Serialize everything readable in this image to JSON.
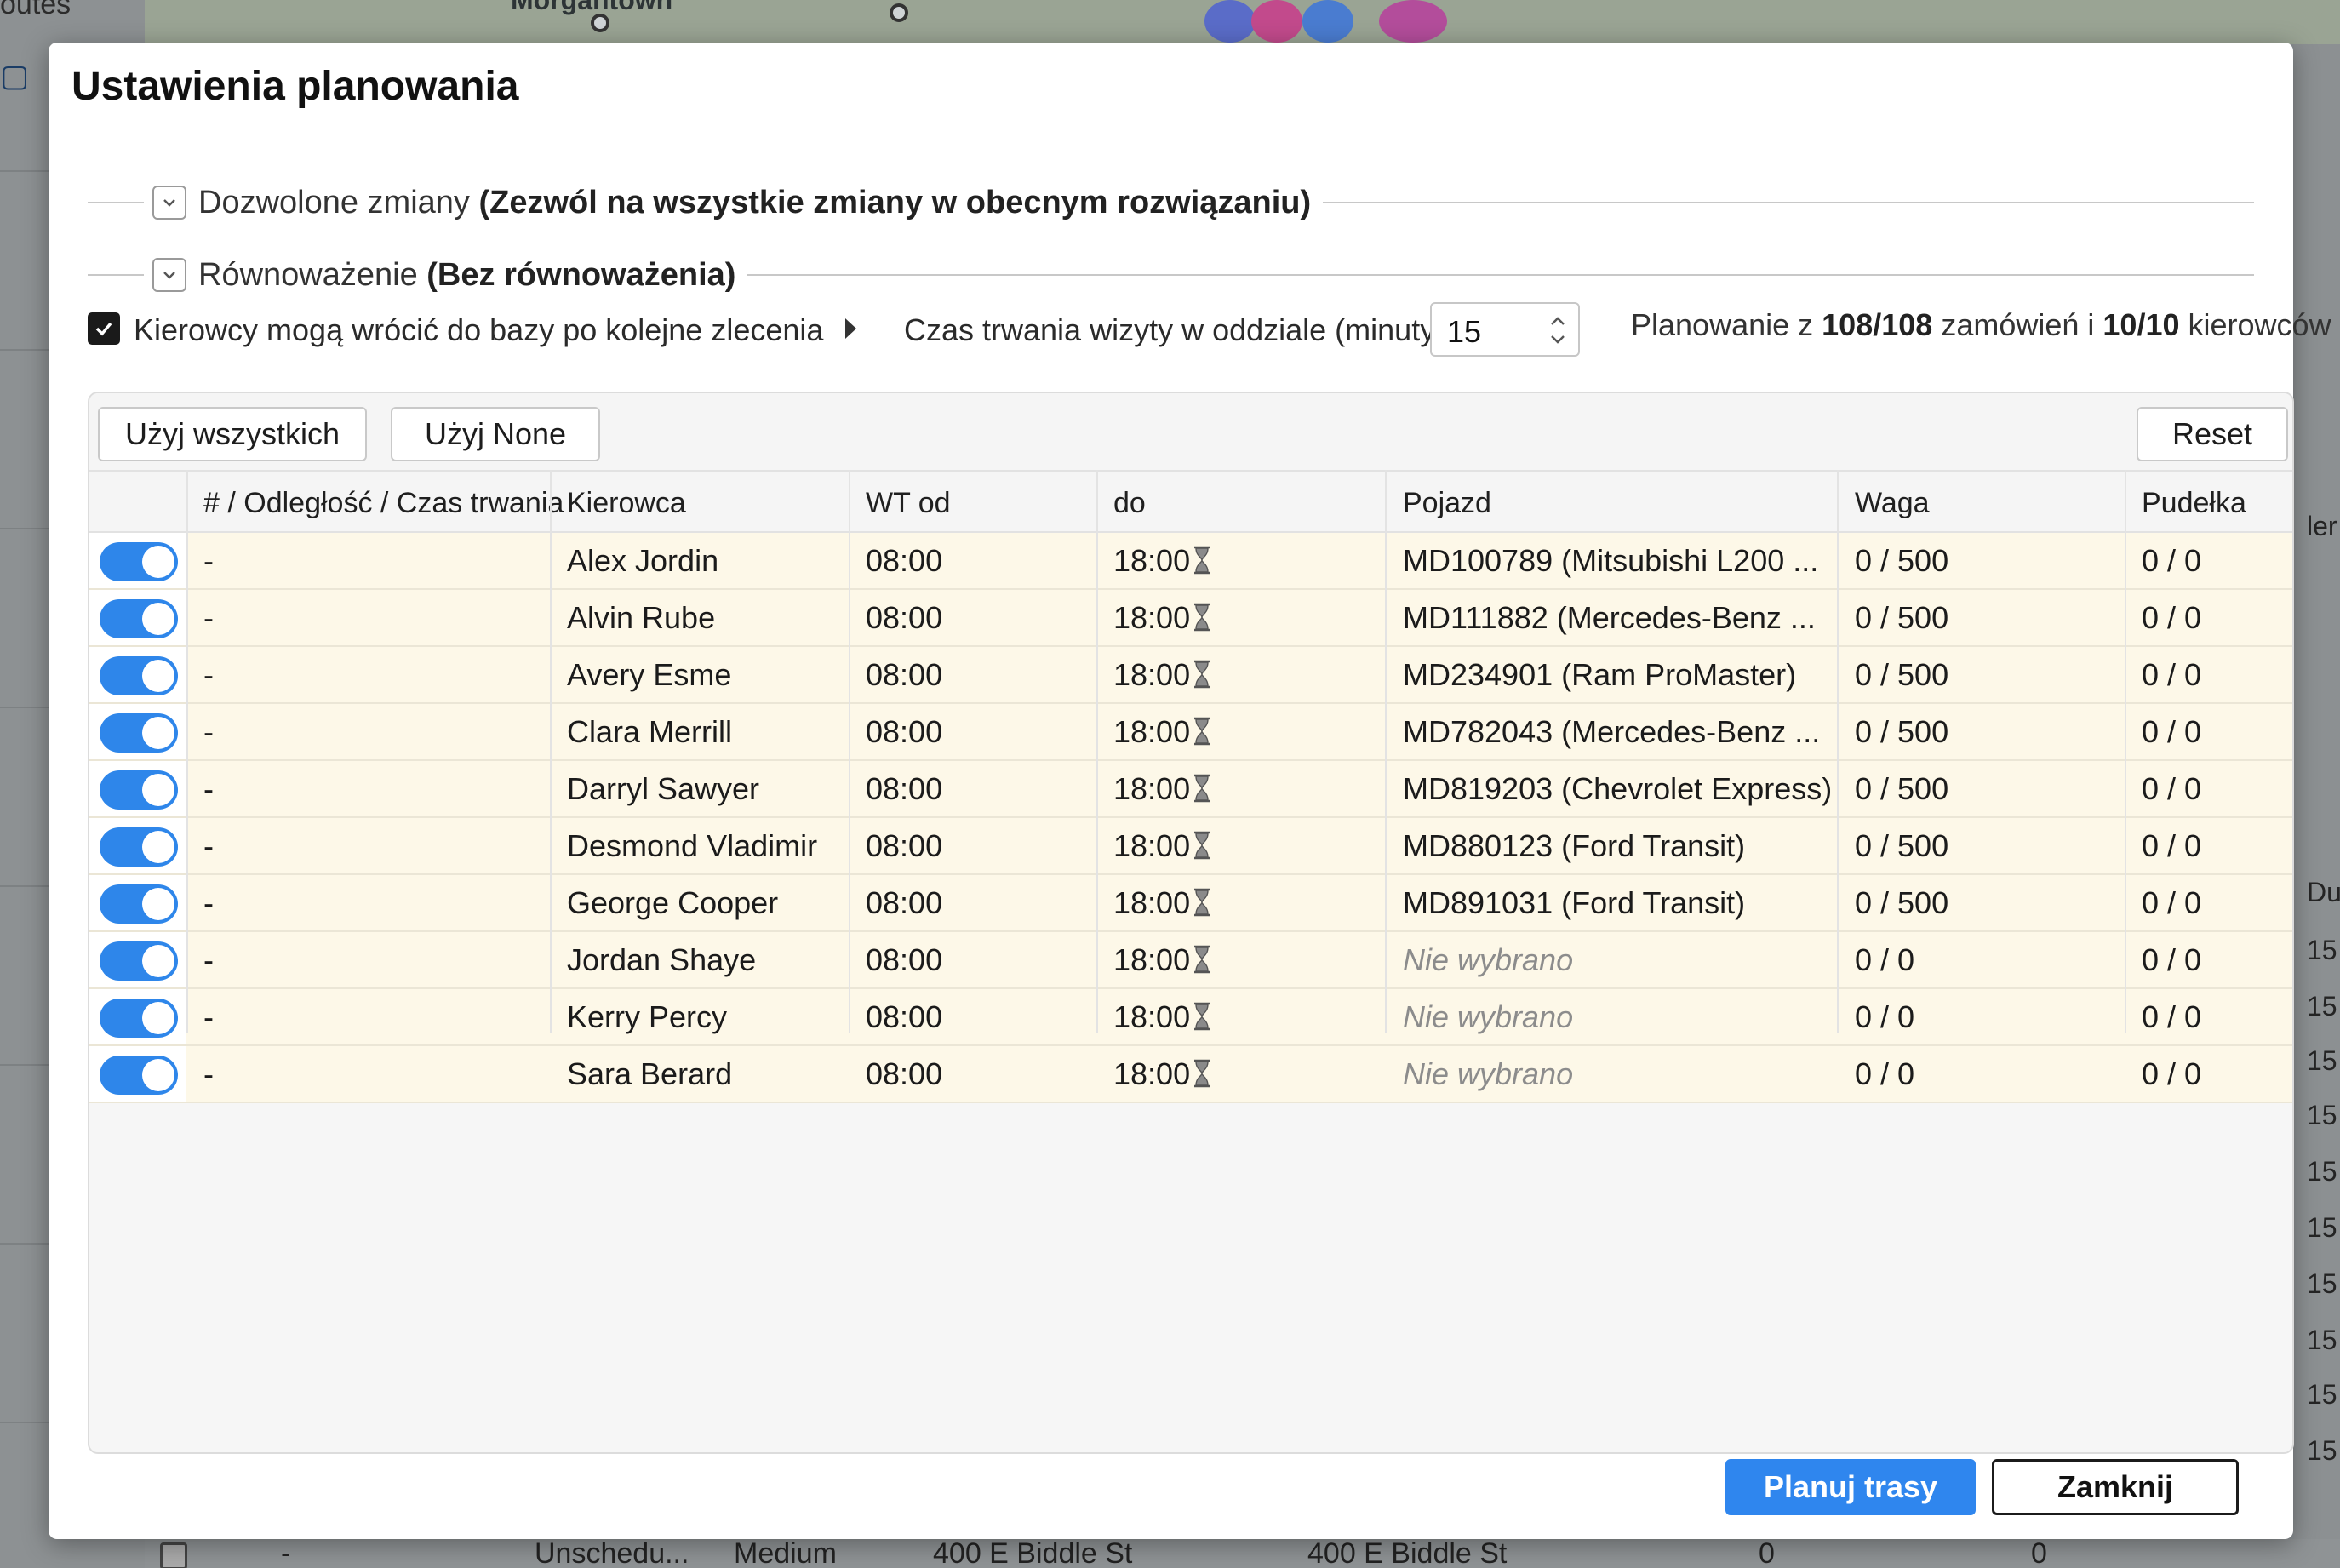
{
  "background": {
    "routes_label": "outes",
    "place_label": "Morgantown",
    "right_labels": [
      "ler",
      "Du",
      "15",
      "15",
      "15",
      "15",
      "15",
      "15",
      "15",
      "15",
      "15",
      "15"
    ],
    "bottom_row": {
      "dash": "-",
      "status": "Unschedu...",
      "priority": "Medium",
      "address_from": "400 E Biddle St",
      "address_to": "400 E Biddle St",
      "val1": "0",
      "val2": "0"
    }
  },
  "dialog": {
    "title": "Ustawienia planowania",
    "sections": [
      {
        "label": "Dozwolone zmiany",
        "detail": "(Zezwól na wszystkie zmiany w obecnym rozwiązaniu)"
      },
      {
        "label": "Równoważenie",
        "detail": "(Bez równoważenia)"
      }
    ],
    "options": {
      "return_to_base_checked": true,
      "return_to_base_label": "Kierowcy mogą wrócić do bazy po kolejne zlecenia",
      "visit_duration_label": "Czas trwania wizyty w oddziale (minuty):",
      "visit_duration_value": "15",
      "summary": {
        "prefix": "Planowanie z",
        "orders": "108/108",
        "middle": "zamówień i",
        "drivers": "10/10",
        "suffix": "kierowców"
      }
    },
    "toolbar": {
      "use_all": "Użyj wszystkich",
      "use_none": "Użyj None",
      "reset": "Reset"
    },
    "table": {
      "columns": [
        "# / Odległość / Czas trwania",
        "Kierowca",
        "WT od",
        "do",
        "Pojazd",
        "Waga",
        "Pudełka"
      ],
      "rows": [
        {
          "enabled": true,
          "dist": "-",
          "driver": "Alex Jordin",
          "from": "08:00",
          "to": "18:00",
          "vehicle": "MD100789 (Mitsubishi L200 ...",
          "vehicle_selected": true,
          "weight": "0 / 500",
          "boxes": "0 / 0"
        },
        {
          "enabled": true,
          "dist": "-",
          "driver": "Alvin Rube",
          "from": "08:00",
          "to": "18:00",
          "vehicle": "MD111882 (Mercedes-Benz ...",
          "vehicle_selected": true,
          "weight": "0 / 500",
          "boxes": "0 / 0"
        },
        {
          "enabled": true,
          "dist": "-",
          "driver": "Avery Esme",
          "from": "08:00",
          "to": "18:00",
          "vehicle": "MD234901 (Ram ProMaster)",
          "vehicle_selected": true,
          "weight": "0 / 500",
          "boxes": "0 / 0"
        },
        {
          "enabled": true,
          "dist": "-",
          "driver": "Clara Merrill",
          "from": "08:00",
          "to": "18:00",
          "vehicle": "MD782043 (Mercedes-Benz ...",
          "vehicle_selected": true,
          "weight": "0 / 500",
          "boxes": "0 / 0"
        },
        {
          "enabled": true,
          "dist": "-",
          "driver": "Darryl Sawyer",
          "from": "08:00",
          "to": "18:00",
          "vehicle": "MD819203 (Chevrolet Express)",
          "vehicle_selected": true,
          "weight": "0 / 500",
          "boxes": "0 / 0"
        },
        {
          "enabled": true,
          "dist": "-",
          "driver": "Desmond Vladimir",
          "from": "08:00",
          "to": "18:00",
          "vehicle": "MD880123 (Ford Transit)",
          "vehicle_selected": true,
          "weight": "0 / 500",
          "boxes": "0 / 0"
        },
        {
          "enabled": true,
          "dist": "-",
          "driver": "George Cooper",
          "from": "08:00",
          "to": "18:00",
          "vehicle": "MD891031 (Ford Transit)",
          "vehicle_selected": true,
          "weight": "0 / 500",
          "boxes": "0 / 0"
        },
        {
          "enabled": true,
          "dist": "-",
          "driver": "Jordan Shaye",
          "from": "08:00",
          "to": "18:00",
          "vehicle": "Nie wybrano",
          "vehicle_selected": false,
          "weight": "0 / 0",
          "boxes": "0 / 0"
        },
        {
          "enabled": true,
          "dist": "-",
          "driver": "Kerry Percy",
          "from": "08:00",
          "to": "18:00",
          "vehicle": "Nie wybrano",
          "vehicle_selected": false,
          "weight": "0 / 0",
          "boxes": "0 / 0"
        },
        {
          "enabled": true,
          "dist": "-",
          "driver": "Sara Berard",
          "from": "08:00",
          "to": "18:00",
          "vehicle": "Nie wybrano",
          "vehicle_selected": false,
          "weight": "0 / 0",
          "boxes": "0 / 0"
        }
      ]
    },
    "footer": {
      "plan_routes": "Planuj trasy",
      "close": "Zamknij"
    }
  },
  "colors": {
    "accent": "#2f86ee",
    "row_highlight": "#fdf8e8",
    "overlay": "#8a8f92"
  }
}
